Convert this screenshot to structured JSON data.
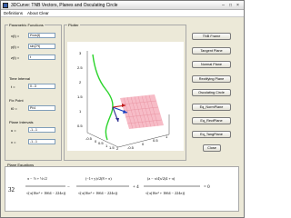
{
  "window": {
    "title": "3DCurve: TNB Vectors, Planes and Osculating Circle",
    "min": "–",
    "max": "□",
    "close": "×"
  },
  "menu": [
    "Definitions",
    "About",
    "Clear"
  ],
  "params": {
    "title": "Parametric Functions",
    "rows": [
      {
        "label": "x(t) =",
        "value": "t*cos(t)"
      },
      {
        "label": "y(t) =",
        "value": "sin(2*t)"
      },
      {
        "label": "z(t) =",
        "value": "t"
      }
    ]
  },
  "time_interval": {
    "title": "Time Interval",
    "label": "t =",
    "value": "0...3"
  },
  "fix_point": {
    "title": "Fix Point",
    "label": "t0 =",
    "value": "Pi/4"
  },
  "plane_intervals": {
    "title": "Plane Intervals",
    "rows": [
      {
        "label": "u =",
        "value": "-1...1"
      },
      {
        "label": "v =",
        "value": "-1...1"
      }
    ]
  },
  "plot": {
    "title": "Plotter",
    "ticks_left": [
      "3",
      "2.5",
      "2",
      "1.5",
      "1",
      "0.5"
    ],
    "ticks_bottom": [
      "-0.5",
      "0",
      "0.5",
      "1",
      "1.5",
      "2"
    ],
    "ticks_side": [
      "-0.5",
      "0",
      "0.5",
      "1"
    ]
  },
  "buttons": [
    "TNB Frame",
    "Tangent Plane",
    "Normal Plane",
    "Rectifying Plane",
    "Osculating Circle",
    "Eq_NormPlane",
    "Eq_RectPlane",
    "Eq_TangPlane",
    "Close"
  ],
  "equations": {
    "title": "Plane Equations",
    "lead": "32",
    "eq_zero": "= 0"
  },
  "colors": {
    "curve": "#2bd42b",
    "tangent": "#1a3fbf",
    "normal": "#c01a1a",
    "binormal": "#2b2b8f",
    "plane": "#f4a6b4"
  }
}
